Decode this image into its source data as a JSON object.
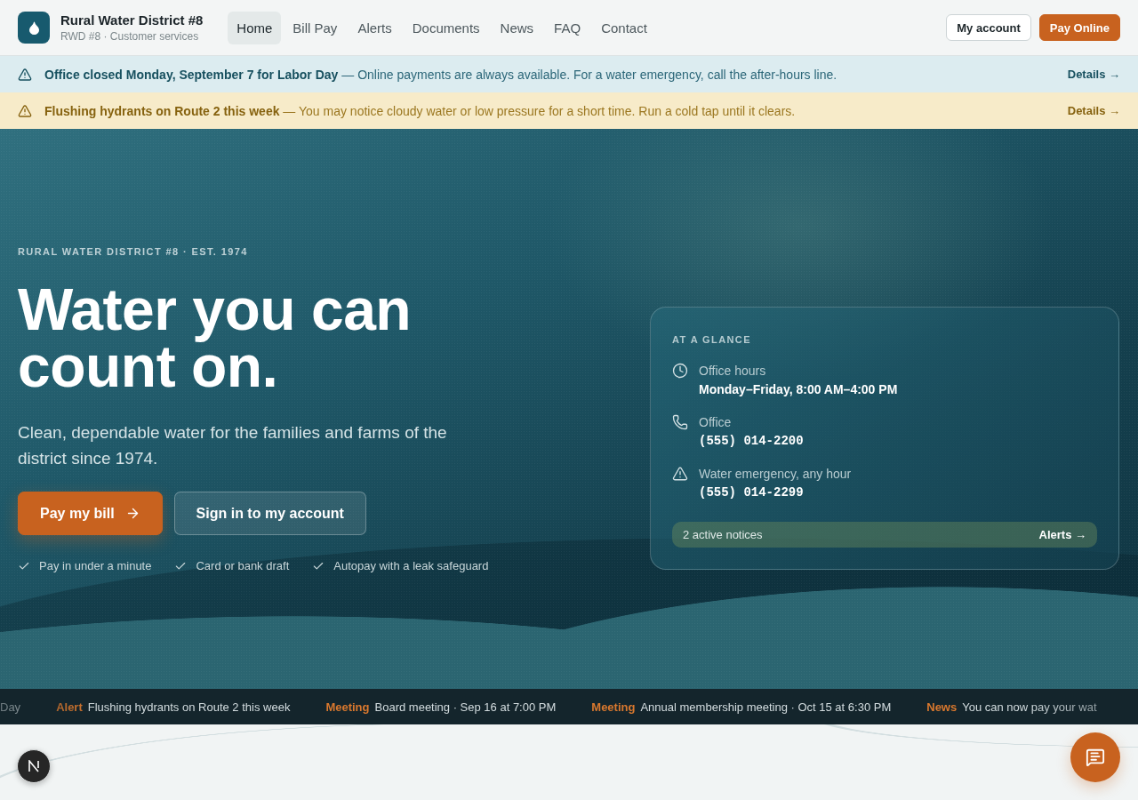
{
  "header": {
    "title": "Rural Water District #8",
    "subtitle": "RWD #8 · Customer services",
    "nav": [
      {
        "label": "Home",
        "selected": true
      },
      {
        "label": "Bill Pay",
        "selected": false
      },
      {
        "label": "Alerts",
        "selected": false
      },
      {
        "label": "Documents",
        "selected": false
      },
      {
        "label": "News",
        "selected": false
      },
      {
        "label": "FAQ",
        "selected": false
      },
      {
        "label": "Contact",
        "selected": false
      }
    ],
    "actions": [
      {
        "label": "My account",
        "kind": "outline"
      },
      {
        "label": "Pay Online",
        "kind": "primary"
      }
    ]
  },
  "notices": [
    {
      "kind": "info",
      "message": "**Office closed Monday, September 7 for Labor Day** — Online payments are always available. For a water emergency, call the after-hours line.",
      "link": "Details →"
    },
    {
      "kind": "warning",
      "message": "**Flushing hydrants on Route 2 this week** — You may notice cloudy water or low pressure for a short time. Run a cold tap until it clears.",
      "link": "Details →"
    }
  ],
  "hero": {
    "eyebrow": "RURAL WATER DISTRICT #8 · EST. 1974",
    "heading": "Water you can count on.",
    "lead": "Clean, dependable water for the families and farms of the district since 1974.",
    "buttons": [
      {
        "label": "Pay my bill",
        "kind": "primary"
      },
      {
        "label": "Sign in to my account",
        "kind": "secondary"
      }
    ],
    "perks": [
      "Pay in under a minute",
      "Card or bank draft",
      "Autopay with a leak safeguard"
    ]
  },
  "glance": {
    "title": "AT A GLANCE",
    "rows": [
      {
        "kind": "hours",
        "label": "Office hours",
        "value": "Monday–Friday, 8:00 AM–4:00 PM"
      },
      {
        "kind": "office",
        "label": "Office",
        "value": "(555) 014-2200"
      },
      {
        "kind": "emergency",
        "label": "Water emergency, any hour",
        "value": "(555) 014-2299"
      }
    ],
    "notice": {
      "text": "2 active notices",
      "link": "Alerts →"
    }
  },
  "ticker": [
    {
      "text": "Day"
    },
    {
      "tag": "Alert",
      "text": "Flushing hydrants on Route 2 this week"
    },
    {
      "tag": "Meeting",
      "text": "Board meeting · Sep 16 at 7:00 PM"
    },
    {
      "tag": "Meeting",
      "text": "Annual membership meeting · Oct 15 at 6:30 PM"
    },
    {
      "tag": "News",
      "text": "You can now pay your wat"
    }
  ]
}
